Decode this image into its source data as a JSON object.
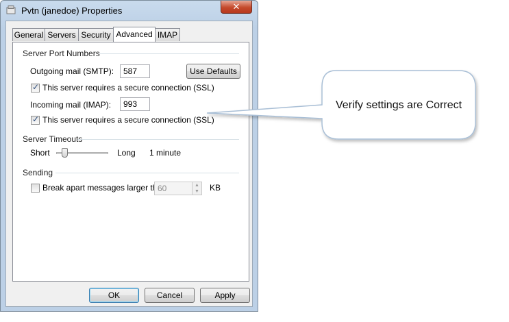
{
  "window": {
    "title": "Pvtn (janedoe) Properties",
    "close_label": "✕"
  },
  "tabs": [
    {
      "label": "General",
      "active": false
    },
    {
      "label": "Servers",
      "active": false
    },
    {
      "label": "Security",
      "active": false
    },
    {
      "label": "Advanced",
      "active": true
    },
    {
      "label": "IMAP",
      "active": false
    }
  ],
  "server_ports": {
    "group_label": "Server Port Numbers",
    "outgoing_label": "Outgoing mail (SMTP):",
    "outgoing_value": "587",
    "use_defaults_label": "Use Defaults",
    "outgoing_ssl_label": "This server requires a secure connection (SSL)",
    "outgoing_ssl_checked": true,
    "incoming_label": "Incoming mail (IMAP):",
    "incoming_value": "993",
    "incoming_ssl_label": "This server requires a secure connection (SSL)",
    "incoming_ssl_checked": true
  },
  "timeouts": {
    "group_label": "Server Timeouts",
    "short_label": "Short",
    "long_label": "Long",
    "value_text": "1 minute",
    "slider_level": 0.12
  },
  "sending": {
    "group_label": "Sending",
    "break_apart_label": "Break apart messages larger than",
    "break_apart_checked": false,
    "size_value": "60",
    "unit_label": "KB"
  },
  "buttons": {
    "ok_label": "OK",
    "cancel_label": "Cancel",
    "apply_label": "Apply"
  },
  "callout": {
    "text": "Verify settings are Correct"
  },
  "colors": {
    "title_bar": "#c9dbed",
    "close_button": "#c44a2c",
    "default_button_border": "#3c7fb1"
  }
}
